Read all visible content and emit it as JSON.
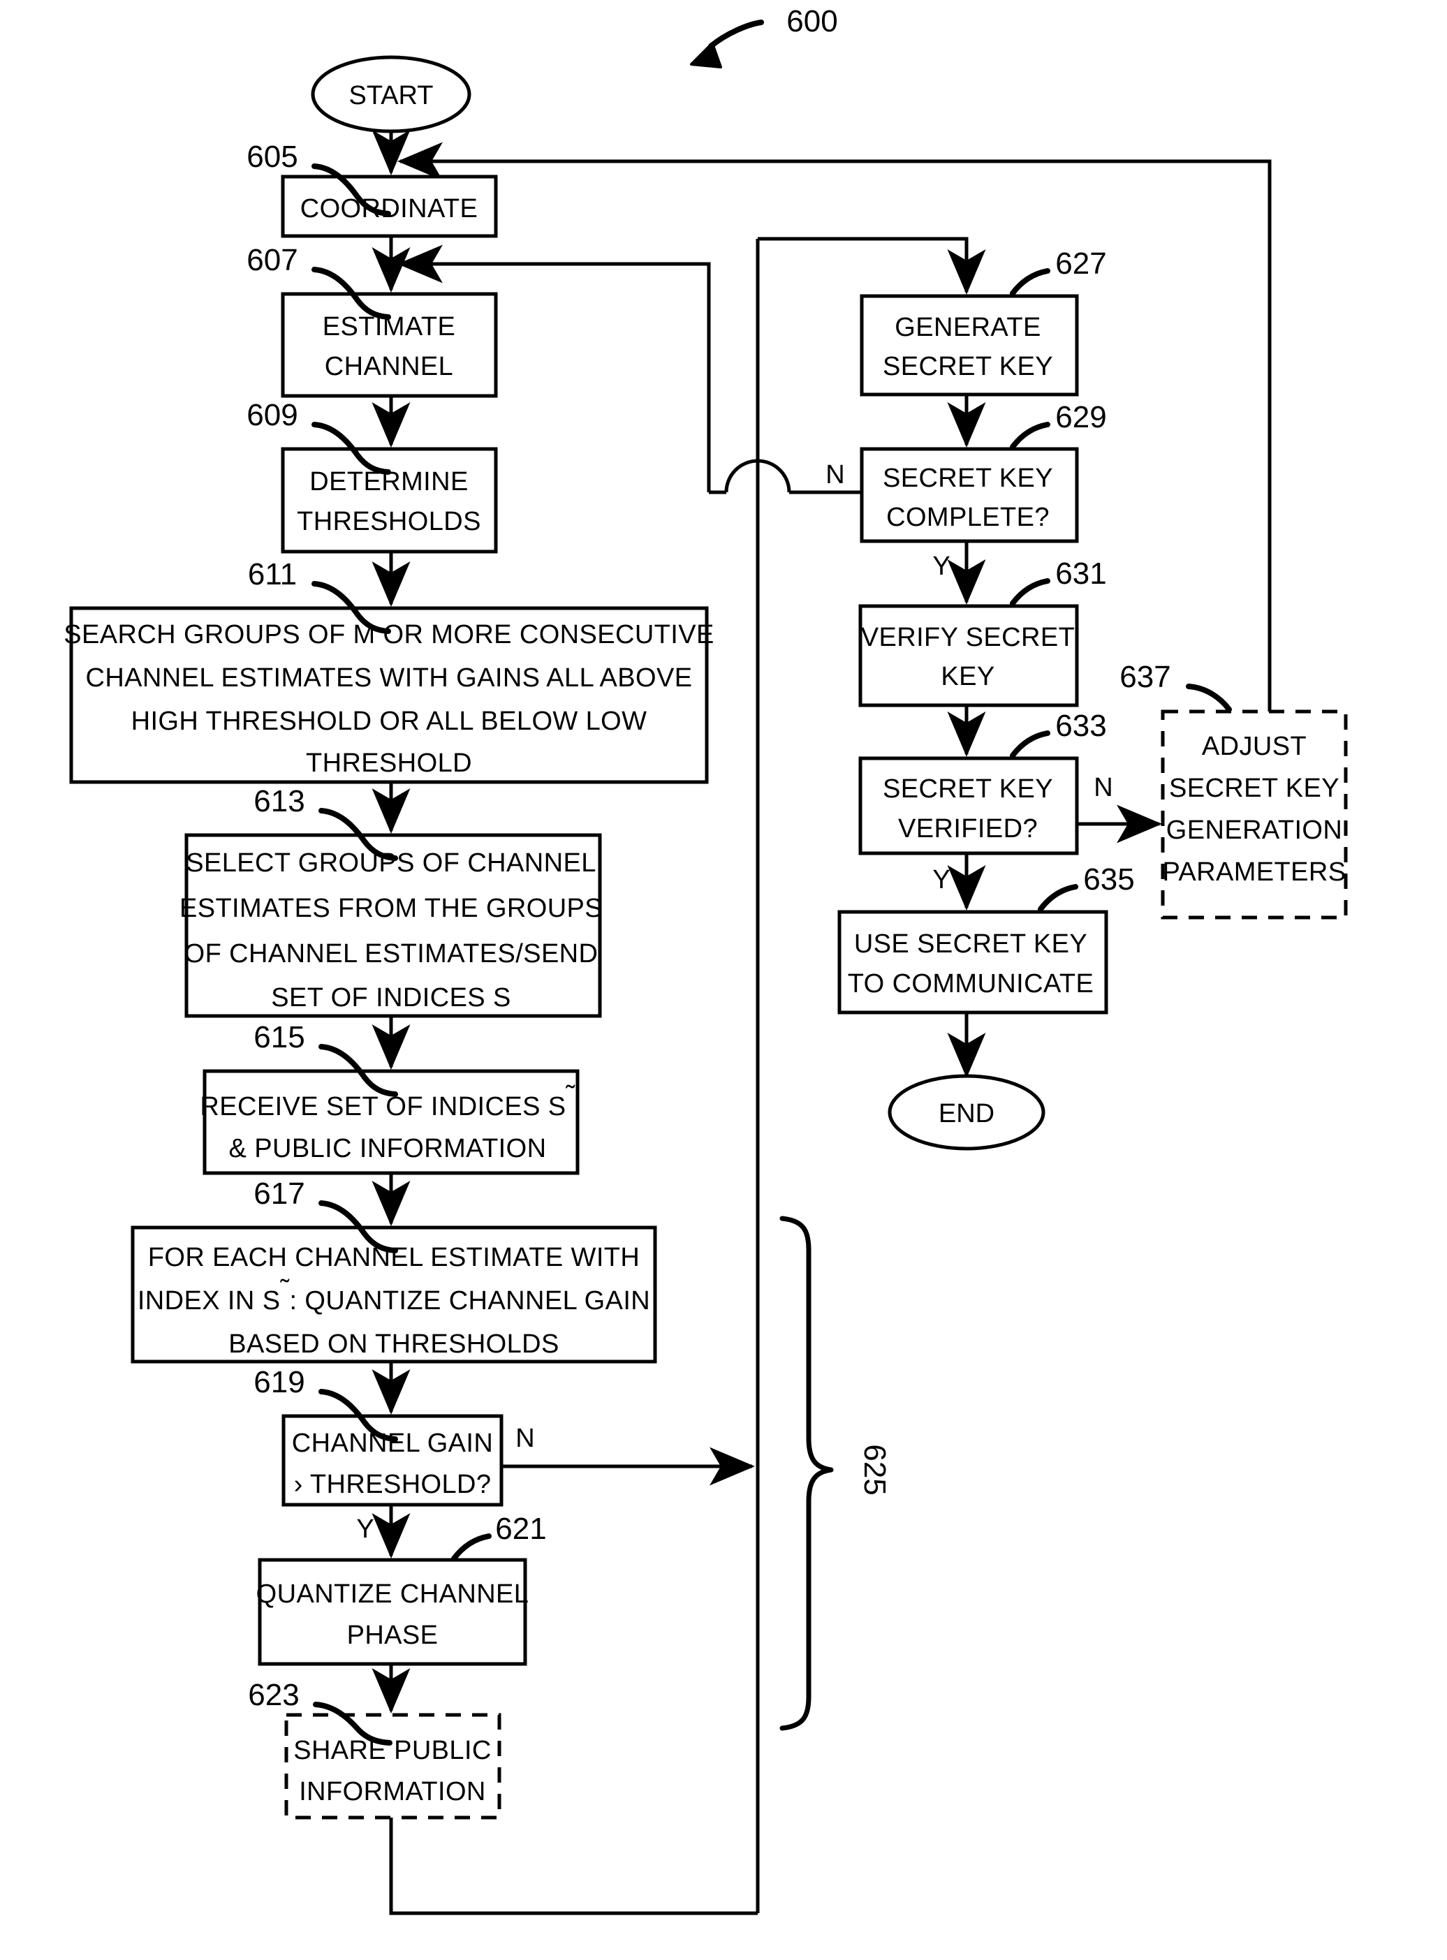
{
  "figure": {
    "number": "600",
    "type": "patent-flowchart"
  },
  "terminators": {
    "start": "START",
    "end": "END"
  },
  "nodes": [
    {
      "ref": "605",
      "lines": [
        "COORDINATE"
      ],
      "style": "solid"
    },
    {
      "ref": "607",
      "lines": [
        "ESTIMATE",
        "CHANNEL"
      ],
      "style": "solid"
    },
    {
      "ref": "609",
      "lines": [
        "DETERMINE",
        "THRESHOLDS"
      ],
      "style": "solid"
    },
    {
      "ref": "611",
      "lines": [
        "SEARCH GROUPS OF M OR MORE CONSECUTIVE",
        "CHANNEL ESTIMATES WITH GAINS ALL ABOVE",
        "HIGH THRESHOLD OR ALL BELOW LOW",
        "THRESHOLD"
      ],
      "style": "solid"
    },
    {
      "ref": "613",
      "lines": [
        "SELECT GROUPS OF CHANNEL",
        "ESTIMATES FROM THE GROUPS",
        "OF CHANNEL ESTIMATES/SEND",
        "SET OF INDICES S"
      ],
      "style": "solid"
    },
    {
      "ref": "615",
      "lines": [
        "RECEIVE SET OF INDICES S̃",
        "& PUBLIC INFORMATION"
      ],
      "style": "solid"
    },
    {
      "ref": "617",
      "lines": [
        "FOR EACH CHANNEL ESTIMATE WITH",
        "INDEX IN S̃: QUANTIZE CHANNEL GAIN",
        "BASED ON THRESHOLDS"
      ],
      "style": "solid"
    },
    {
      "ref": "619",
      "lines": [
        "CHANNEL GAIN",
        "› THRESHOLD?"
      ],
      "style": "solid"
    },
    {
      "ref": "621",
      "lines": [
        "QUANTIZE CHANNEL",
        "PHASE"
      ],
      "style": "solid"
    },
    {
      "ref": "623",
      "lines": [
        "SHARE PUBLIC",
        "INFORMATION"
      ],
      "style": "dashed"
    },
    {
      "ref": "627",
      "lines": [
        "GENERATE",
        "SECRET KEY"
      ],
      "style": "solid"
    },
    {
      "ref": "629",
      "lines": [
        "SECRET KEY",
        "COMPLETE?"
      ],
      "style": "solid"
    },
    {
      "ref": "631",
      "lines": [
        "VERIFY SECRET",
        "KEY"
      ],
      "style": "solid"
    },
    {
      "ref": "633",
      "lines": [
        "SECRET KEY",
        "VERIFIED?"
      ],
      "style": "solid"
    },
    {
      "ref": "635",
      "lines": [
        "USE SECRET KEY",
        "TO COMMUNICATE"
      ],
      "style": "solid"
    },
    {
      "ref": "637",
      "lines": [
        "ADJUST",
        "SECRET KEY",
        "GENERATION",
        "PARAMETERS"
      ],
      "style": "dashed"
    }
  ],
  "group_brace": {
    "ref": "625"
  },
  "branch_labels": {
    "n_619": "N",
    "y_619": "Y",
    "n_629": "N",
    "y_629": "Y",
    "n_633": "N",
    "y_633": "Y"
  },
  "node_text": {
    "n605_l0": "COORDINATE",
    "n607_l0": "ESTIMATE",
    "n607_l1": "CHANNEL",
    "n609_l0": "DETERMINE",
    "n609_l1": "THRESHOLDS",
    "n611_l0": "SEARCH GROUPS OF M OR MORE CONSECUTIVE",
    "n611_l1": "CHANNEL ESTIMATES WITH GAINS ALL ABOVE",
    "n611_l2": "HIGH THRESHOLD OR ALL BELOW LOW",
    "n611_l3": "THRESHOLD",
    "n613_l0": "SELECT GROUPS OF CHANNEL",
    "n613_l1": "ESTIMATES FROM THE GROUPS",
    "n613_l2": "OF CHANNEL ESTIMATES/SEND",
    "n613_l3": "SET OF INDICES S",
    "n615_l0": "RECEIVE SET OF INDICES S",
    "n615_l1": "& PUBLIC INFORMATION",
    "n617_l0": "FOR EACH CHANNEL ESTIMATE WITH",
    "n617_l1a": "INDEX IN S",
    "n617_l1b": ": QUANTIZE CHANNEL GAIN",
    "n617_l2": "BASED ON THRESHOLDS",
    "n619_l0": "CHANNEL GAIN",
    "n619_l1": "› THRESHOLD?",
    "n621_l0": "QUANTIZE CHANNEL",
    "n621_l1": "PHASE",
    "n623_l0": "SHARE PUBLIC",
    "n623_l1": "INFORMATION",
    "n627_l0": "GENERATE",
    "n627_l1": "SECRET KEY",
    "n629_l0": "SECRET KEY",
    "n629_l1": "COMPLETE?",
    "n631_l0": "VERIFY SECRET",
    "n631_l1": "KEY",
    "n633_l0": "SECRET KEY",
    "n633_l1": "VERIFIED?",
    "n635_l0": "USE SECRET KEY",
    "n635_l1": "TO COMMUNICATE",
    "n637_l0": "ADJUST",
    "n637_l1": "SECRET KEY",
    "n637_l2": "GENERATION",
    "n637_l3": "PARAMETERS"
  },
  "ref_labels": {
    "r600": "600",
    "r605": "605",
    "r607": "607",
    "r609": "609",
    "r611": "611",
    "r613": "613",
    "r615": "615",
    "r617": "617",
    "r619": "619",
    "r621": "621",
    "r623": "623",
    "r625": "625",
    "r627": "627",
    "r629": "629",
    "r631": "631",
    "r633": "633",
    "r635": "635",
    "r637": "637"
  },
  "colors": {
    "stroke": "#000000",
    "background": "#ffffff"
  }
}
